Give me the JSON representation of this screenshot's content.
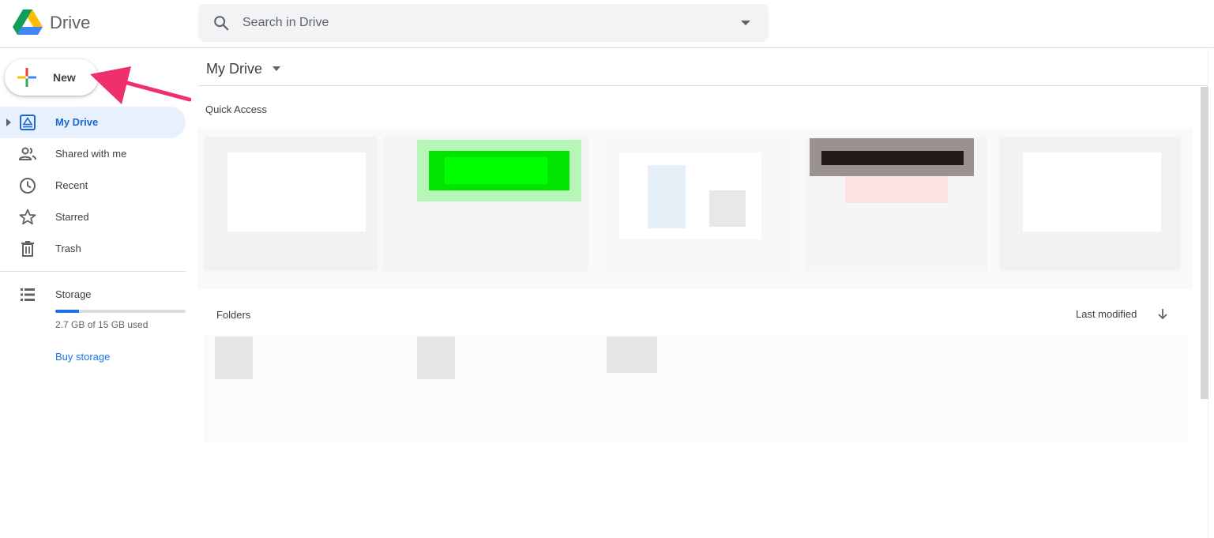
{
  "header": {
    "app_name": "Drive",
    "search": {
      "placeholder": "Search in Drive"
    }
  },
  "sidebar": {
    "new_button": {
      "label": "New"
    },
    "items": [
      {
        "label": "My Drive",
        "icon": "my-drive-icon",
        "active": true
      },
      {
        "label": "Shared with me",
        "icon": "shared-with-me-icon",
        "active": false
      },
      {
        "label": "Recent",
        "icon": "clock-icon",
        "active": false
      },
      {
        "label": "Starred",
        "icon": "star-icon",
        "active": false
      },
      {
        "label": "Trash",
        "icon": "trash-icon",
        "active": false
      }
    ],
    "storage": {
      "label": "Storage",
      "usage_text": "2.7 GB of 15 GB used",
      "used_fraction": 0.18,
      "buy_label": "Buy storage"
    }
  },
  "main": {
    "breadcrumb": {
      "title": "My Drive"
    },
    "quick_access": {
      "label": "Quick Access"
    },
    "folders": {
      "label": "Folders",
      "sort_label": "Last modified",
      "sort_direction": "descending"
    }
  },
  "colors": {
    "accent": "#1a73e8",
    "active_bg": "#e8f0fe",
    "annotation_arrow": "#f0306b"
  }
}
